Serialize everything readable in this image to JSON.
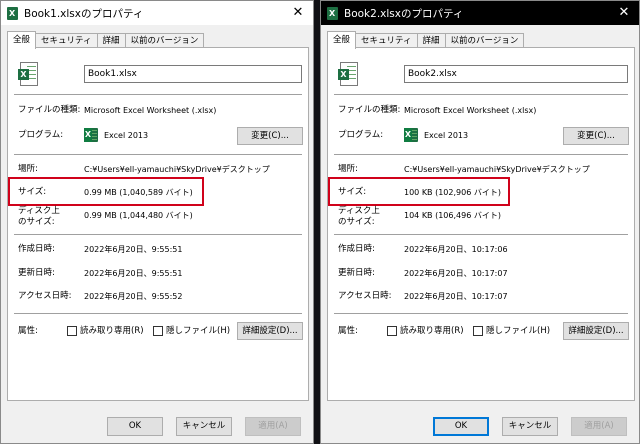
{
  "left": {
    "title": "Book1.xlsxのプロパティ",
    "close": "✕",
    "tabs": [
      "全般",
      "セキュリティ",
      "詳細",
      "以前のバージョン"
    ],
    "name_value": "Book1.xlsx",
    "labels": {
      "filetype": "ファイルの種類:",
      "program": "プログラム:",
      "location": "場所:",
      "size": "サイズ:",
      "disk_line1": "ディスク上",
      "disk_line2": "のサイズ:",
      "created": "作成日時:",
      "modified": "更新日時:",
      "accessed": "アクセス日時:",
      "attributes": "属性:"
    },
    "values": {
      "filetype": "Microsoft Excel Worksheet (.xlsx)",
      "program": "Excel 2013",
      "location": "C:¥Users¥ell-yamauchi¥SkyDrive¥デスクトップ",
      "size": "0.99 MB (1,040,589 バイト)",
      "disk": "0.99 MB (1,044,480 バイト)",
      "created": "2022年6月20日、9:55:51",
      "modified": "2022年6月20日、9:55:51",
      "accessed": "2022年6月20日、9:55:52"
    },
    "buttons": {
      "change": "変更(C)...",
      "readonly": "読み取り専用(R)",
      "hidden": "隠しファイル(H)",
      "advanced": "詳細設定(D)...",
      "ok": "OK",
      "cancel": "キャンセル",
      "apply": "適用(A)"
    }
  },
  "right": {
    "title": "Book2.xlsxのプロパティ",
    "close": "✕",
    "tabs": [
      "全般",
      "セキュリティ",
      "詳細",
      "以前のバージョン"
    ],
    "name_value": "Book2.xlsx",
    "labels": {
      "filetype": "ファイルの種類:",
      "program": "プログラム:",
      "location": "場所:",
      "size": "サイズ:",
      "disk_line1": "ディスク上",
      "disk_line2": "のサイズ:",
      "created": "作成日時:",
      "modified": "更新日時:",
      "accessed": "アクセス日時:",
      "attributes": "属性:"
    },
    "values": {
      "filetype": "Microsoft Excel Worksheet (.xlsx)",
      "program": "Excel 2013",
      "location": "C:¥Users¥ell-yamauchi¥SkyDrive¥デスクトップ",
      "size": "100 KB (102,906 バイト)",
      "disk": "104 KB (106,496 バイト)",
      "created": "2022年6月20日、10:17:06",
      "modified": "2022年6月20日、10:17:07",
      "accessed": "2022年6月20日、10:17:07"
    },
    "buttons": {
      "change": "変更(C)...",
      "readonly": "読み取り専用(R)",
      "hidden": "隠しファイル(H)",
      "advanced": "詳細設定(D)...",
      "ok": "OK",
      "cancel": "キャンセル",
      "apply": "適用(A)"
    }
  },
  "colors": {
    "highlight": "#d0021b",
    "excel_green": "#1d6f42",
    "dialog_bg": "#f0f0f0"
  },
  "icons": {
    "title": "excel-file-icon",
    "file": "excel-document-icon",
    "program": "excel-app-icon",
    "close": "close-icon"
  }
}
